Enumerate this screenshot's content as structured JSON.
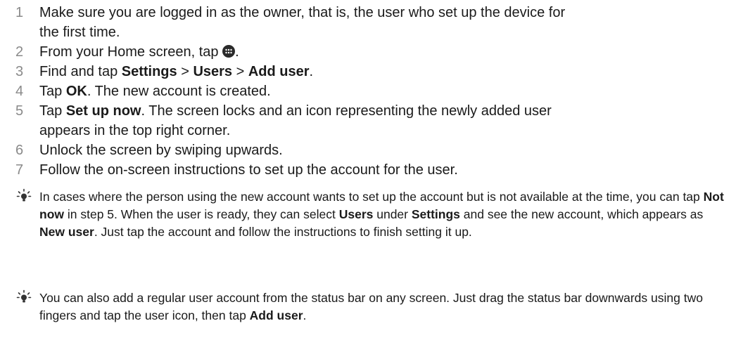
{
  "steps": [
    {
      "num": "1",
      "parts": [
        {
          "t": "Make sure you are logged in as the owner, that is, the user who set up the device for the first time."
        }
      ]
    },
    {
      "num": "2",
      "parts": [
        {
          "t": "From your Home screen, tap "
        },
        {
          "icon": "apps-grid-icon"
        },
        {
          "t": "."
        }
      ]
    },
    {
      "num": "3",
      "parts": [
        {
          "t": "Find and tap "
        },
        {
          "b": "Settings"
        },
        {
          "t": " > "
        },
        {
          "b": "Users"
        },
        {
          "t": " > "
        },
        {
          "b": "Add user"
        },
        {
          "t": "."
        }
      ]
    },
    {
      "num": "4",
      "parts": [
        {
          "t": "Tap "
        },
        {
          "b": "OK"
        },
        {
          "t": ". The new account is created."
        }
      ]
    },
    {
      "num": "5",
      "parts": [
        {
          "t": "Tap "
        },
        {
          "b": "Set up now"
        },
        {
          "t": ". The screen locks and an icon representing the newly added user appears in the top right corner."
        }
      ]
    },
    {
      "num": "6",
      "parts": [
        {
          "t": "Unlock the screen by swiping upwards."
        }
      ]
    },
    {
      "num": "7",
      "parts": [
        {
          "t": "Follow the on-screen instructions to set up the account for the user."
        }
      ]
    }
  ],
  "tips": [
    {
      "icon": "lightbulb-tip-icon",
      "parts": [
        {
          "t": "In cases where the person using the new account wants to set up the account but is not available at the time, you can tap "
        },
        {
          "b": "Not now"
        },
        {
          "t": " in step 5. When the user is ready, they can select "
        },
        {
          "b": "Users"
        },
        {
          "t": " under "
        },
        {
          "b": "Settings"
        },
        {
          "t": " and see the new account, which appears as "
        },
        {
          "b": "New user"
        },
        {
          "t": ". Just tap the account and follow the instructions to finish setting it up."
        }
      ]
    },
    {
      "icon": "lightbulb-tip-icon",
      "parts": [
        {
          "t": "You can also add a regular user account from the status bar on any screen. Just drag the status bar downwards using two fingers and tap the user icon, then tap "
        },
        {
          "b": "Add user"
        },
        {
          "t": "."
        }
      ]
    }
  ]
}
